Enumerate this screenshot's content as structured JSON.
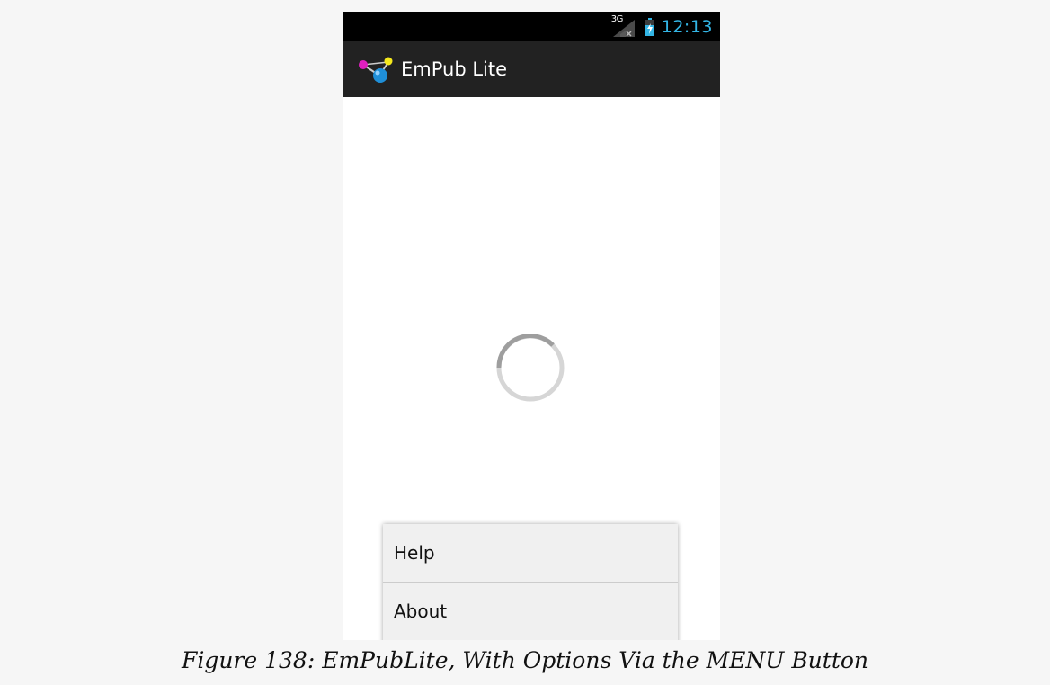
{
  "status_bar": {
    "network_type": "3G",
    "time": "12:13",
    "icons": [
      "signal-icon",
      "battery-icon"
    ],
    "colors": {
      "background": "#000000",
      "clock": "#33b5e5"
    }
  },
  "action_bar": {
    "app_icon": "empub-app-icon",
    "title": "EmPub Lite",
    "colors": {
      "background": "#222222",
      "title": "#ffffff"
    }
  },
  "content": {
    "loading_indicator": "progress-spinner-icon"
  },
  "options_menu": {
    "items": [
      {
        "label": "Help"
      },
      {
        "label": "About"
      }
    ],
    "colors": {
      "background": "#f0f0f0",
      "divider": "#cccccc"
    }
  },
  "caption": {
    "text": "Figure 138: EmPubLite, With Options Via the MENU Button"
  }
}
